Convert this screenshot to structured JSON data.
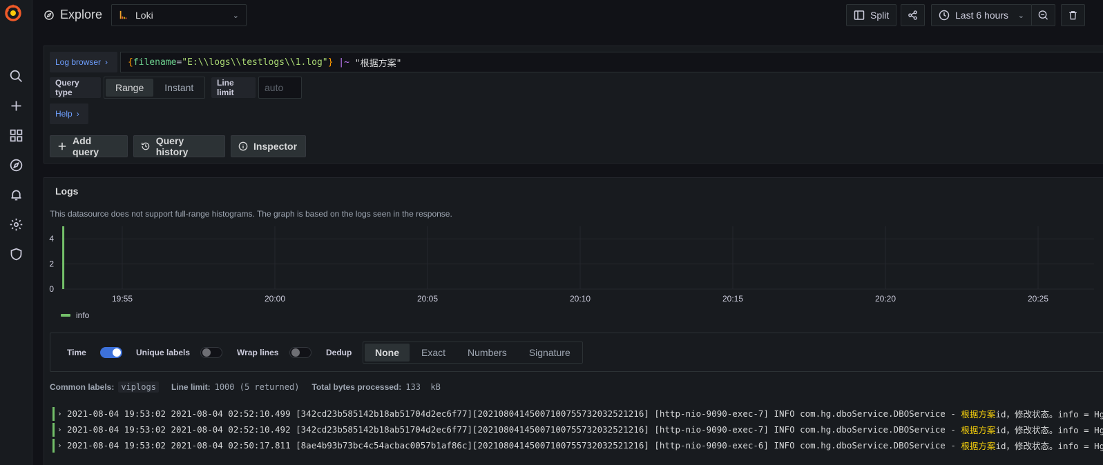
{
  "sidebar": {
    "logo": "grafana-logo",
    "items": [
      {
        "icon": "search-icon"
      },
      {
        "icon": "plus-icon"
      },
      {
        "icon": "dashboards-icon"
      },
      {
        "icon": "explore-icon"
      },
      {
        "icon": "alerting-bell-icon"
      },
      {
        "icon": "gear-icon"
      },
      {
        "icon": "shield-icon"
      }
    ]
  },
  "header": {
    "title": "Explore",
    "datasource": "Loki",
    "split_label": "Split",
    "time_range": "Last 6 hours"
  },
  "query": {
    "log_browser_label": "Log browser",
    "expr": {
      "open": "{",
      "key": "filename",
      "eq": "=",
      "value": "\"E:\\\\logs\\\\testlogs\\\\1.log\"",
      "close": "}",
      "op": "|~",
      "filter": "\"根据方案\""
    },
    "query_type_label": "Query type",
    "query_types": [
      "Range",
      "Instant"
    ],
    "query_type_selected": "Range",
    "line_limit_label": "Line limit",
    "line_limit_placeholder": "auto",
    "help_label": "Help",
    "add_query_label": "Add query",
    "query_history_label": "Query history",
    "inspector_label": "Inspector"
  },
  "logs": {
    "title": "Logs",
    "note": "This datasource does not support full-range histograms. The graph is based on the logs seen in the response.",
    "options": {
      "time_label": "Time",
      "time_on": true,
      "unique_labels_label": "Unique labels",
      "unique_labels_on": false,
      "wrap_lines_label": "Wrap lines",
      "wrap_lines_on": false,
      "dedup_label": "Dedup",
      "dedup_options": [
        "None",
        "Exact",
        "Numbers",
        "Signature"
      ],
      "dedup_selected": "None"
    },
    "meta": {
      "common_labels_key": "Common labels:",
      "common_labels_value": "viplogs",
      "line_limit_key": "Line limit:",
      "line_limit_value": "1000 (5 returned)",
      "total_bytes_key": "Total bytes processed:",
      "total_bytes_value": "133  kB"
    },
    "rows": [
      {
        "pre": "2021-08-04 19:53:02 2021-08-04 02:52:10.499 [342cd23b585142b18ab51704d2ec6f77][202108041450071007557320325212​16] [http-nio-9090-exec-7] INFO com.hg.dboService.DBOService - ",
        "hl": "根据方案",
        "post": "id，修改状态。info = HgFlowPlan"
      },
      {
        "pre": "2021-08-04 19:53:02 2021-08-04 02:52:10.492 [342cd23b585142b18ab51704d2ec6f77][202108041450071007557320325212​16] [http-nio-9090-exec-7] INFO com.hg.dboService.DBOService - ",
        "hl": "根据方案",
        "post": "id，修改状态。info = HgFlowPlan"
      },
      {
        "pre": "2021-08-04 19:53:02 2021-08-04 02:50:17.811 [8ae4b93b73bc4c54acbac0057b1af86c][202108041450071007557320325212​16] [http-nio-9090-exec-6] INFO com.hg.dboService.DBOService - ",
        "hl": "根据方案",
        "post": "id，修改状态。info = HgFlowPlan"
      }
    ]
  },
  "chart_data": {
    "type": "bar",
    "title": "",
    "xlabel": "",
    "ylabel": "",
    "x_ticks": [
      "19:55",
      "20:00",
      "20:05",
      "20:10",
      "20:15",
      "20:20",
      "20:25"
    ],
    "y_ticks": [
      0,
      2,
      4
    ],
    "ylim": [
      0,
      5
    ],
    "series": [
      {
        "name": "info",
        "color": "#73bf69",
        "points": [
          {
            "x": "19:53:02",
            "y": 5
          }
        ]
      }
    ],
    "grid": true,
    "legend": "bottom-left"
  }
}
